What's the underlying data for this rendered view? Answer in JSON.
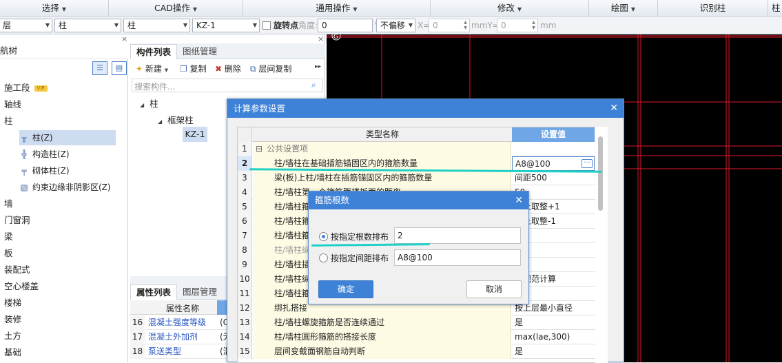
{
  "top_menu": [
    "选择",
    "CAD操作",
    "通用操作",
    "修改",
    "绘图",
    "识别柱",
    "柱"
  ],
  "combo_bar": {
    "floor": "层",
    "type": "柱",
    "subtype": "柱",
    "element": "KZ-1",
    "rotate_label": "旋转点",
    "angle_label": "角度:",
    "angle_value": "0",
    "angle_unit": "°",
    "offset": "不偏移",
    "x_label": "X=",
    "x_value": "0",
    "mm1": "mmY=",
    "y_value": "0",
    "mm2": "mm"
  },
  "left_panel": {
    "title": "航树",
    "items": [
      "施工段",
      "轴线",
      "柱",
      "墙",
      "门窗洞",
      "梁",
      "板",
      "装配式",
      "空心楼盖",
      "楼梯",
      "装修",
      "土方",
      "基础"
    ],
    "vip": "VIP",
    "sub_items": [
      "柱(Z)",
      "构造柱(Z)",
      "砌体柱(Z)",
      "约束边缘非阴影区(Z)"
    ]
  },
  "mid_panel": {
    "tabs": [
      "构件列表",
      "图纸管理"
    ],
    "toolbar": [
      "新建",
      "复制",
      "删除",
      "层间复制"
    ],
    "search_placeholder": "搜索构件...",
    "tree": [
      "柱",
      "框架柱",
      "KZ-1"
    ],
    "prop_tabs": [
      "属性列表",
      "图层管理"
    ],
    "prop_header": "属性名称",
    "props": [
      {
        "num": "16",
        "name": "混凝土强度等级",
        "val": "(C"
      },
      {
        "num": "17",
        "name": "混凝土外加剂",
        "val": "(无"
      },
      {
        "num": "18",
        "name": "泵送类型",
        "val": "(混"
      }
    ]
  },
  "dialog": {
    "title": "计算参数设置",
    "col_name": "类型名称",
    "col_value": "设置值",
    "rows": [
      {
        "num": "1",
        "name": "公共设置项",
        "val": ""
      },
      {
        "num": "2",
        "name": "柱/墙柱在基础插筋锚固区内的箍筋数量",
        "val": "A8@100"
      },
      {
        "num": "3",
        "name": "梁(板)上柱/墙柱在插筋锚固区内的箍筋数量",
        "val": "间距500"
      },
      {
        "num": "4",
        "name": "柱/墙柱第一个箍筋距楼板面的距离",
        "val": "50"
      },
      {
        "num": "5",
        "name": "柱/墙柱箍",
        "val": "向上取整+1"
      },
      {
        "num": "6",
        "name": "柱/墙柱箍",
        "val": "向上取整-1"
      },
      {
        "num": "7",
        "name": "柱/墙柱箍",
        "val": ""
      },
      {
        "num": "8",
        "name": "柱/墙柱纵",
        "val": ""
      },
      {
        "num": "9",
        "name": "柱/墙柱插",
        "val": ""
      },
      {
        "num": "10",
        "name": "柱/墙柱纵",
        "val": "按规范计算"
      },
      {
        "num": "11",
        "name": "柱/墙柱箍",
        "val": ""
      },
      {
        "num": "12",
        "name": "绑扎搭接",
        "val": "按上层最小直径"
      },
      {
        "num": "13",
        "name": "柱/墙柱螺旋箍筋是否连续通过",
        "val": "是"
      },
      {
        "num": "14",
        "name": "柱/墙柱圆形箍筋的搭接长度",
        "val": "max(lae,300)"
      },
      {
        "num": "15",
        "name": "层间变截面钢筋自动判断",
        "val": "是"
      }
    ]
  },
  "sub_dialog": {
    "title": "箍筋根数",
    "opt1_label": "按指定根数排布",
    "opt1_value": "2",
    "opt2_label": "按指定间距排布",
    "opt2_value": "A8@100",
    "ok": "确定",
    "cancel": "取消"
  },
  "colors": {
    "accent": "#3e82d8",
    "annotation": "#1fd0c6",
    "cad_grid": "#e0182d"
  }
}
